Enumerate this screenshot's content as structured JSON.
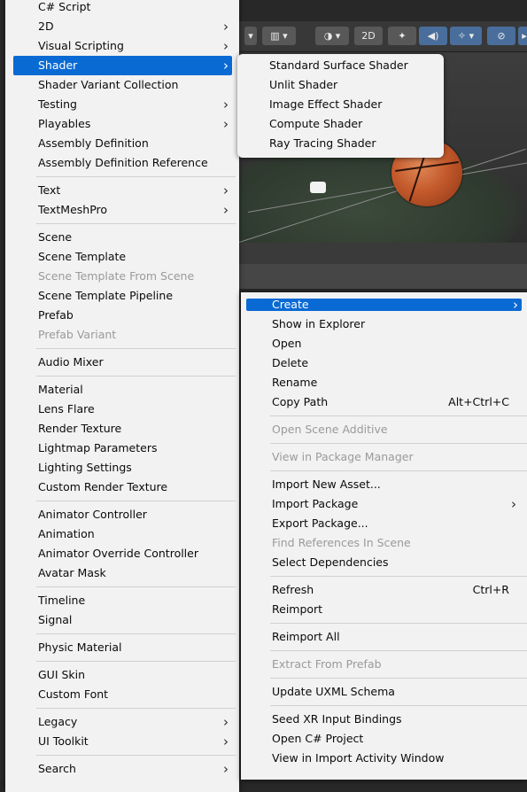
{
  "left_menu": {
    "items": [
      {
        "label": "C# Script"
      },
      {
        "label": "2D",
        "submenu": true
      },
      {
        "label": "Visual Scripting",
        "submenu": true
      },
      {
        "label": "Shader",
        "submenu": true,
        "highlighted": true
      },
      {
        "label": "Shader Variant Collection"
      },
      {
        "label": "Testing",
        "submenu": true
      },
      {
        "label": "Playables",
        "submenu": true
      },
      {
        "label": "Assembly Definition"
      },
      {
        "label": "Assembly Definition Reference"
      },
      {
        "separator": true
      },
      {
        "label": "Text",
        "submenu": true
      },
      {
        "label": "TextMeshPro",
        "submenu": true
      },
      {
        "separator": true
      },
      {
        "label": "Scene"
      },
      {
        "label": "Scene Template"
      },
      {
        "label": "Scene Template From Scene",
        "disabled": true
      },
      {
        "label": "Scene Template Pipeline"
      },
      {
        "label": "Prefab"
      },
      {
        "label": "Prefab Variant",
        "disabled": true
      },
      {
        "separator": true
      },
      {
        "label": "Audio Mixer"
      },
      {
        "separator": true
      },
      {
        "label": "Material"
      },
      {
        "label": "Lens Flare"
      },
      {
        "label": "Render Texture"
      },
      {
        "label": "Lightmap Parameters"
      },
      {
        "label": "Lighting Settings"
      },
      {
        "label": "Custom Render Texture"
      },
      {
        "separator": true
      },
      {
        "label": "Animator Controller"
      },
      {
        "label": "Animation"
      },
      {
        "label": "Animator Override Controller"
      },
      {
        "label": "Avatar Mask"
      },
      {
        "separator": true
      },
      {
        "label": "Timeline"
      },
      {
        "label": "Signal"
      },
      {
        "separator": true
      },
      {
        "label": "Physic Material"
      },
      {
        "separator": true
      },
      {
        "label": "GUI Skin"
      },
      {
        "label": "Custom Font"
      },
      {
        "separator": true
      },
      {
        "label": "Legacy",
        "submenu": true
      },
      {
        "label": "UI Toolkit",
        "submenu": true
      },
      {
        "separator": true
      },
      {
        "label": "Search",
        "submenu": true
      }
    ]
  },
  "shader_menu": {
    "items": [
      {
        "label": "Standard Surface Shader"
      },
      {
        "label": "Unlit Shader"
      },
      {
        "label": "Image Effect Shader"
      },
      {
        "label": "Compute Shader"
      },
      {
        "label": "Ray Tracing Shader"
      }
    ]
  },
  "context_menu": {
    "items": [
      {
        "label": "Create",
        "submenu": true,
        "highlighted": true
      },
      {
        "label": "Show in Explorer"
      },
      {
        "label": "Open"
      },
      {
        "label": "Delete"
      },
      {
        "label": "Rename"
      },
      {
        "label": "Copy Path",
        "shortcut": "Alt+Ctrl+C"
      },
      {
        "separator": true
      },
      {
        "label": "Open Scene Additive",
        "disabled": true
      },
      {
        "separator": true
      },
      {
        "label": "View in Package Manager",
        "disabled": true
      },
      {
        "separator": true
      },
      {
        "label": "Import New Asset..."
      },
      {
        "label": "Import Package",
        "submenu": true
      },
      {
        "label": "Export Package..."
      },
      {
        "label": "Find References In Scene",
        "disabled": true
      },
      {
        "label": "Select Dependencies"
      },
      {
        "separator": true
      },
      {
        "label": "Refresh",
        "shortcut": "Ctrl+R"
      },
      {
        "label": "Reimport"
      },
      {
        "separator": true
      },
      {
        "label": "Reimport All"
      },
      {
        "separator": true
      },
      {
        "label": "Extract From Prefab",
        "disabled": true
      },
      {
        "separator": true
      },
      {
        "label": "Update UXML Schema"
      },
      {
        "separator": true
      },
      {
        "label": "Seed XR Input Bindings"
      },
      {
        "label": "Open C# Project"
      },
      {
        "label": "View in Import Activity Window"
      }
    ]
  },
  "scene_toolbar": {
    "toggle_2d_label": "2D",
    "icons": [
      "grid-icon",
      "shading-sphere-icon",
      "2d-toggle",
      "lighting-icon",
      "audio-icon",
      "effects-icon",
      "visibility-icon",
      "gizmos-icon"
    ]
  },
  "colors": {
    "menu_bg": "#f2f2f2",
    "highlight": "#0a6ad4",
    "disabled_text": "#9a9a9a",
    "separator": "#d0d0d0",
    "editor_bg": "#282828"
  }
}
